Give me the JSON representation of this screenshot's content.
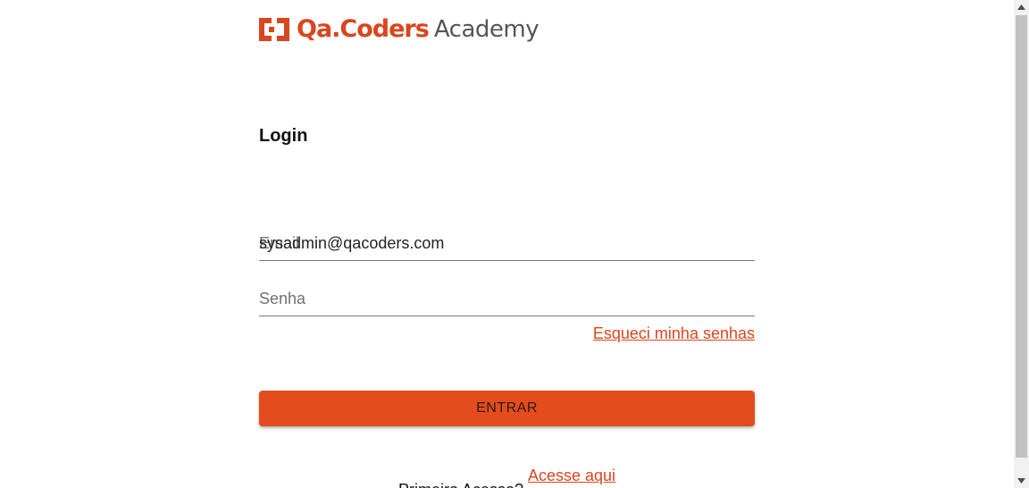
{
  "logo": {
    "brand": "Qa.Coders",
    "sub": "Academy",
    "brand_color": "#d9461f"
  },
  "login": {
    "title": "Login",
    "email_label": "Email",
    "email_value": "sysadmin@qacoders.com",
    "password_label": "Senha",
    "forgot_link": "Esqueci minha senhas",
    "submit_button": "ENTRAR",
    "first_access_text": "Primeiro Acesso?",
    "access_link": "Acesse aqui"
  },
  "colors": {
    "accent": "#e34c1c",
    "link": "#d9461f"
  }
}
